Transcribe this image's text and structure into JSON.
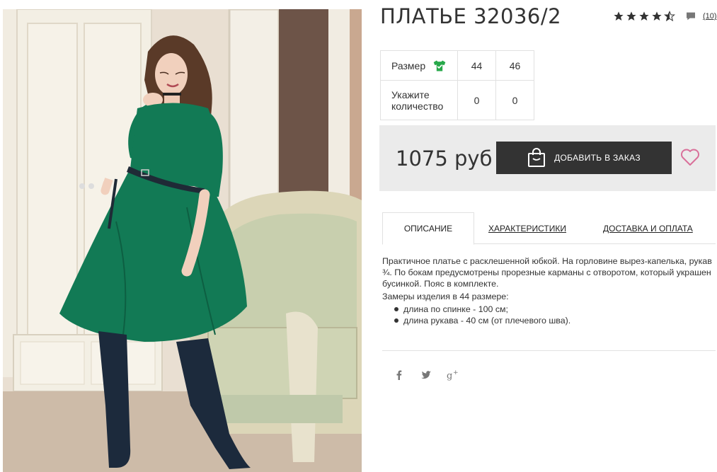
{
  "product": {
    "title": "ПЛАТЬЕ 32036/2",
    "rating": 4.5,
    "review_count": "(10)",
    "price": "1075 руб"
  },
  "sizes_table": {
    "size_label": "Размер",
    "quantity_label": "Укажите количество",
    "sizes": [
      "44",
      "46"
    ],
    "quantities": [
      "0",
      "0"
    ]
  },
  "buy": {
    "add_button_label": "ДОБАВИТЬ В ЗАКАЗ"
  },
  "tabs": [
    {
      "label": "ОПИСАНИЕ",
      "active": true
    },
    {
      "label": "ХАРАКТЕРИСТИКИ",
      "active": false
    },
    {
      "label": "ДОСТАВКА И ОПЛАТА",
      "active": false
    }
  ],
  "description": {
    "text": "Практичное платье с расклешенной юбкой. На горловине вырез-капелька, рукав ¾. По бокам предусмотрены прорезные карманы с отворотом, который украшен бусинкой. Пояс в комплекте.",
    "measures_title": "Замеры изделия в 44 размере:",
    "measures": [
      "длина по спинке - 100 см;",
      "длина рукава - 40 см (от плечевого шва)."
    ]
  },
  "social": [
    "facebook-icon",
    "twitter-icon",
    "google-plus-icon"
  ],
  "colors": {
    "accent_pink": "#d9709a",
    "check_green": "#27a84a",
    "button_dark": "#333333",
    "dress_green": "#127a55"
  }
}
